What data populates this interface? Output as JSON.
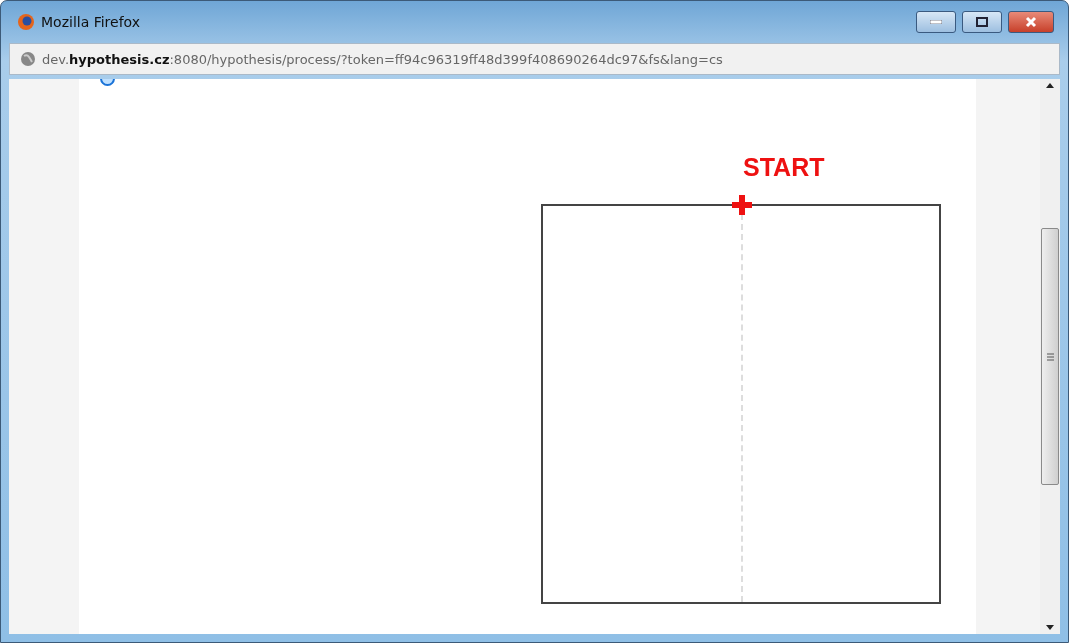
{
  "window": {
    "title": "Mozilla Firefox"
  },
  "address_bar": {
    "url": "dev.**hypothesis.cz**:8080/hypothesis/process/?token=ff94c96319ff48d399f408690264dc97&fs&lang=cs"
  },
  "canvas": {
    "start_label": "START"
  }
}
